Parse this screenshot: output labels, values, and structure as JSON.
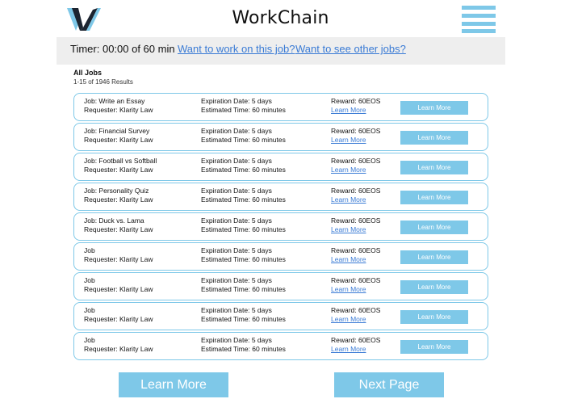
{
  "header": {
    "app_title": "WorkChain"
  },
  "timer_bar": {
    "timer_text": "Timer: 00:00 of 60 min",
    "work_link": "Want to work on this job?",
    "other_link": "Want to see other jobs?"
  },
  "listing": {
    "title": "All Jobs",
    "count": "1-15 of 1946 Results"
  },
  "jobs": [
    {
      "job": "Job: Write an Essay",
      "requester": "Requester: Klarity Law",
      "expiration": "Expiration Date: 5 days",
      "estimated": "Estimated Time: 60 minutes",
      "reward": "Reward: 60EOS",
      "link": "Learn More",
      "button": "Learn More"
    },
    {
      "job": "Job: Financial Survey",
      "requester": "Requester: Klarity Law",
      "expiration": "Expiration Date: 5 days",
      "estimated": "Estimated Time: 60 minutes",
      "reward": "Reward: 60EOS",
      "link": "Learn More",
      "button": "Learn More"
    },
    {
      "job": "Job: Football vs Softball",
      "requester": "Requester: Klarity Law",
      "expiration": "Expiration Date: 5 days",
      "estimated": "Estimated Time: 60 minutes",
      "reward": "Reward: 60EOS",
      "link": "Learn More",
      "button": "Learn More"
    },
    {
      "job": "Job: Personality Quiz",
      "requester": "Requester: Klarity Law",
      "expiration": "Expiration Date: 5 days",
      "estimated": "Estimated Time: 60 minutes",
      "reward": "Reward: 60EOS",
      "link": "Learn More",
      "button": "Learn More"
    },
    {
      "job": "Job: Duck vs. Lama",
      "requester": "Requester: Klarity Law",
      "expiration": "Expiration Date: 5 days",
      "estimated": "Estimated Time: 60 minutes",
      "reward": "Reward: 60EOS",
      "link": "Learn More",
      "button": "Learn More"
    },
    {
      "job": "Job",
      "requester": "Requester: Klarity Law",
      "expiration": "Expiration Date: 5 days",
      "estimated": "Estimated Time: 60 minutes",
      "reward": "Reward: 60EOS",
      "link": "Learn More",
      "button": "Learn More"
    },
    {
      "job": "Job",
      "requester": "Requester: Klarity Law",
      "expiration": "Expiration Date: 5 days",
      "estimated": "Estimated Time: 60 minutes",
      "reward": "Reward: 60EOS",
      "link": "Learn More",
      "button": "Learn More"
    },
    {
      "job": "Job",
      "requester": "Requester: Klarity Law",
      "expiration": "Expiration Date: 5 days",
      "estimated": "Estimated Time: 60 minutes",
      "reward": "Reward: 60EOS",
      "link": "Learn More",
      "button": "Learn More"
    },
    {
      "job": "Job",
      "requester": "Requester: Klarity Law",
      "expiration": "Expiration Date: 5 days",
      "estimated": "Estimated Time: 60 minutes",
      "reward": "Reward: 60EOS",
      "link": "Learn More",
      "button": "Learn More"
    }
  ],
  "footer": {
    "learn_more": "Learn More",
    "next_page": "Next Page"
  },
  "colors": {
    "accent": "#7ec8e8",
    "logo_dark": "#1c2430",
    "link": "#3a7bd5"
  }
}
